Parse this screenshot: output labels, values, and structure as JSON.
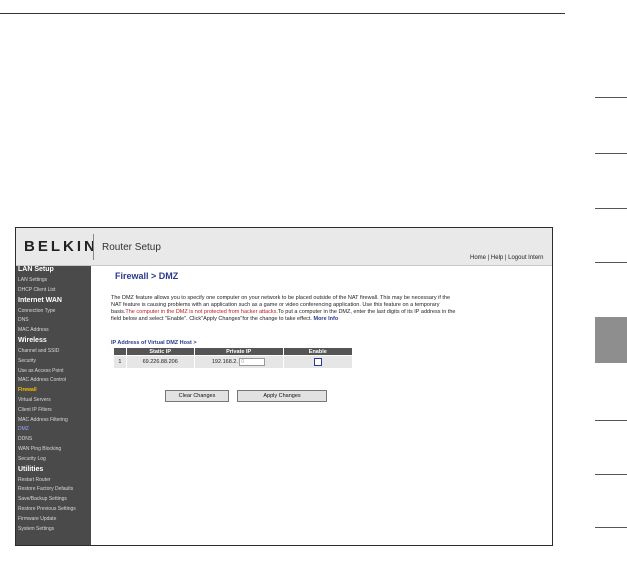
{
  "header": {
    "brand": "BELKIN",
    "app_title": "Router Setup",
    "links": "Home | Help | Logout   Intern"
  },
  "sidebar": [
    {
      "label": "LAN Setup",
      "kind": "head"
    },
    {
      "label": "LAN Settings",
      "kind": "item"
    },
    {
      "label": "DHCP Client List",
      "kind": "item"
    },
    {
      "label": "Internet WAN",
      "kind": "head"
    },
    {
      "label": "Connection Type",
      "kind": "item"
    },
    {
      "label": "DNS",
      "kind": "item"
    },
    {
      "label": "MAC Address",
      "kind": "item"
    },
    {
      "label": "Wireless",
      "kind": "head"
    },
    {
      "label": "Channel and SSID",
      "kind": "item"
    },
    {
      "label": "Security",
      "kind": "item"
    },
    {
      "label": "Use as Access Point",
      "kind": "item"
    },
    {
      "label": "MAC Address Control",
      "kind": "item"
    },
    {
      "label": "Firewall",
      "kind": "active"
    },
    {
      "label": "Virtual Servers",
      "kind": "item"
    },
    {
      "label": "Client IP Filters",
      "kind": "item"
    },
    {
      "label": "MAC Address Filtering",
      "kind": "item"
    },
    {
      "label": "DMZ",
      "kind": "current"
    },
    {
      "label": "DDNS",
      "kind": "item"
    },
    {
      "label": "WAN Ping Blocking",
      "kind": "item"
    },
    {
      "label": "Security Log",
      "kind": "item"
    },
    {
      "label": "Utilities",
      "kind": "head"
    },
    {
      "label": "Restart Router",
      "kind": "item"
    },
    {
      "label": "Restore Factory Defaults",
      "kind": "item"
    },
    {
      "label": "Save/Backup Settings",
      "kind": "item"
    },
    {
      "label": "Restore Previous Settings",
      "kind": "item"
    },
    {
      "label": "Firmware Update",
      "kind": "item"
    },
    {
      "label": "System Settings",
      "kind": "item"
    }
  ],
  "main": {
    "title": "Firewall > DMZ",
    "description": {
      "p1": "The DMZ feature allows you to specify one computer on your network to be placed outside of the NAT firewall. This may be necessary if the NAT feature is causing problems with an application such as a game or video conferencing application. Use this feature on a temporary basis.",
      "warning": "The computer in the DMZ is not protected from hacker attacks.",
      "p2": "To put a computer in the DMZ, enter the last digits of its IP address in the field below and select \"Enable\". Click\"Apply Changes\"for the change to take effect.",
      "more_info": "More Info"
    },
    "section_title": "IP Address of Virtual DMZ Host >",
    "table": {
      "headers": [
        "",
        "Static IP",
        "Private IP",
        "Enable"
      ],
      "rows": [
        {
          "index": "1",
          "static_ip": "69.226.88.206",
          "private_prefix": "192.168.2.",
          "private_last": "0",
          "enabled": false
        }
      ]
    },
    "buttons": {
      "clear": "Clear Changes",
      "apply": "Apply Changes"
    }
  }
}
